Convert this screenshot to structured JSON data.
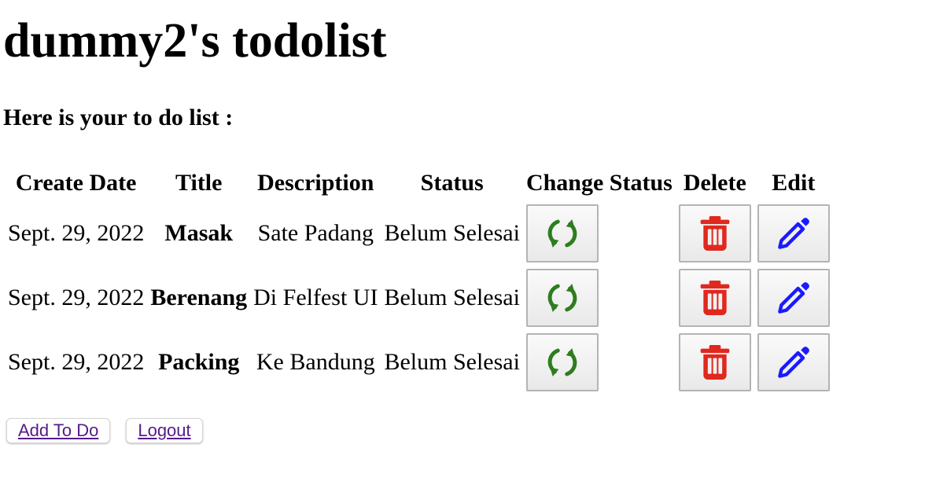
{
  "page": {
    "title": "dummy2's todolist",
    "subtitle": "Here is your to do list :"
  },
  "table": {
    "headers": {
      "create_date": "Create Date",
      "title": "Title",
      "description": "Description",
      "status": "Status",
      "change_status": "Change Status",
      "delete": "Delete",
      "edit": "Edit"
    },
    "rows": [
      {
        "create_date": "Sept. 29, 2022",
        "title": "Masak",
        "description": "Sate Padang",
        "status": "Belum Selesai"
      },
      {
        "create_date": "Sept. 29, 2022",
        "title": "Berenang",
        "description": "Di Felfest UI",
        "status": "Belum Selesai"
      },
      {
        "create_date": "Sept. 29, 2022",
        "title": "Packing",
        "description": "Ke Bandung",
        "status": "Belum Selesai"
      }
    ]
  },
  "icons": {
    "change_status": "refresh-icon",
    "delete": "trash-icon",
    "edit": "pencil-icon"
  },
  "colors": {
    "refresh": "#2e7d1e",
    "delete": "#e0281e",
    "edit": "#1a1aff",
    "link": "#551a8b"
  },
  "actions": {
    "add_todo": "Add To Do",
    "logout": "Logout"
  }
}
